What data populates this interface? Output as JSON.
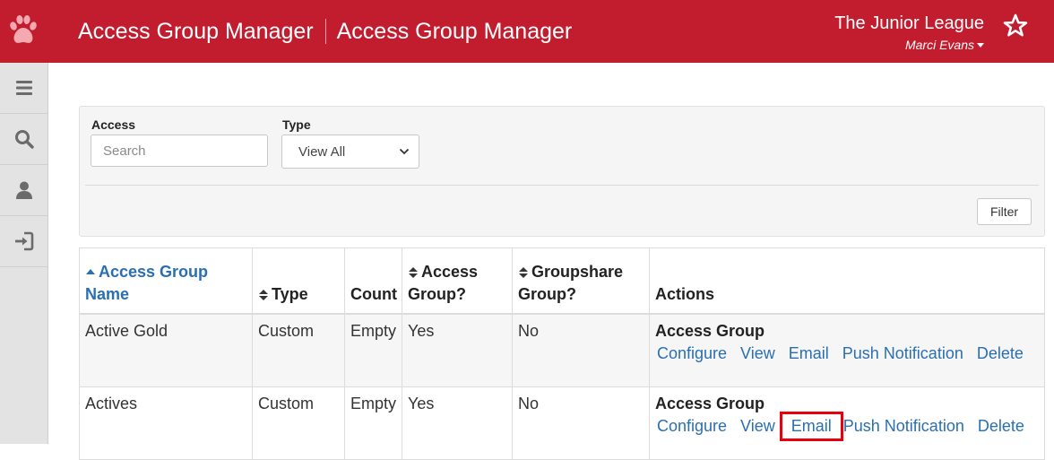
{
  "header": {
    "title_primary": "Access Group Manager",
    "title_secondary": "Access Group Manager",
    "org_name": "The Junior League",
    "user_name": "Marci Evans",
    "brand_color": "#c11d2f",
    "logo_icon": "paw-print-icon",
    "favorite_icon": "star-outline-icon"
  },
  "sidebar": {
    "items": [
      {
        "icon": "menu-icon"
      },
      {
        "icon": "search-icon"
      },
      {
        "icon": "user-icon"
      },
      {
        "icon": "sign-in-icon"
      }
    ]
  },
  "filter": {
    "access_label": "Access",
    "access_placeholder": "Search",
    "access_value": "",
    "type_label": "Type",
    "type_selected": "View All",
    "filter_button": "Filter"
  },
  "table": {
    "columns": [
      {
        "label": "Access Group Name",
        "sort": "asc",
        "active": true
      },
      {
        "label": "Type",
        "sort": "both"
      },
      {
        "label": "Count",
        "sort": "none"
      },
      {
        "label": "Access Group?",
        "sort": "both"
      },
      {
        "label": "Groupshare Group?",
        "sort": "both"
      },
      {
        "label": "Actions",
        "sort": "none"
      }
    ],
    "rows": [
      {
        "name": "Active Gold",
        "type": "Custom",
        "count": "Empty",
        "access_group": "Yes",
        "groupshare_group": "No",
        "actions_title": "Access Group",
        "actions": [
          "Configure",
          "View",
          "Email",
          "Push Notification",
          "Delete"
        ]
      },
      {
        "name": "Actives",
        "type": "Custom",
        "count": "Empty",
        "access_group": "Yes",
        "groupshare_group": "No",
        "actions_title": "Access Group",
        "actions": [
          "Configure",
          "View",
          "Email",
          "Push Notification",
          "Delete"
        ]
      }
    ]
  },
  "colors": {
    "link": "#2a6fb1",
    "highlight_box": "#e8000d"
  }
}
